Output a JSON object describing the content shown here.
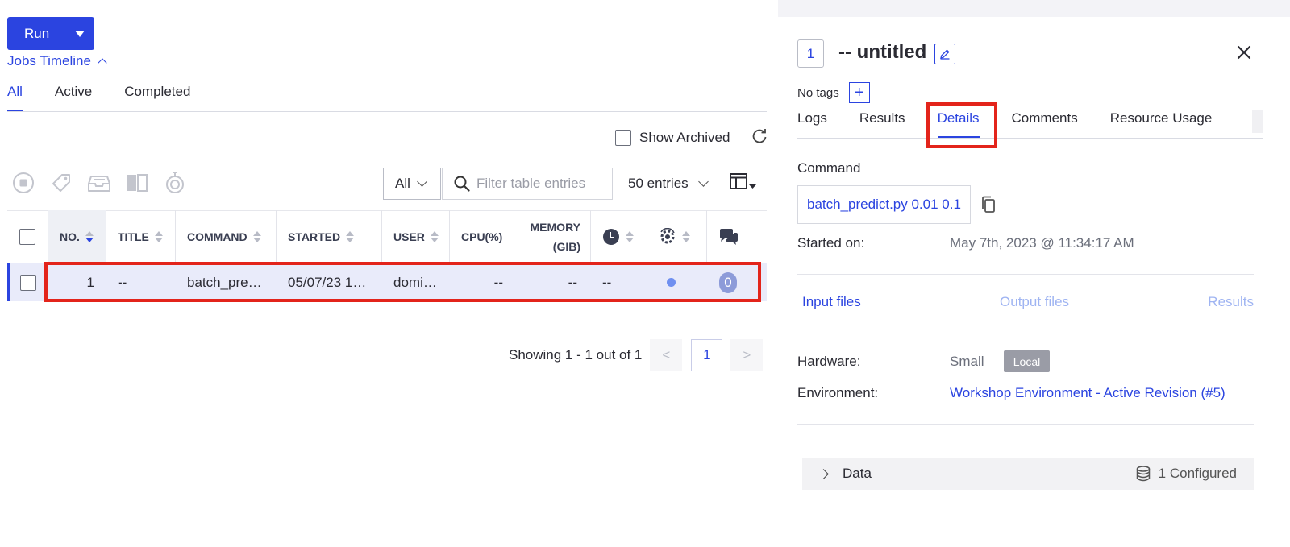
{
  "left": {
    "run_button": {
      "label": "Run"
    },
    "timeline_link": "Jobs Timeline",
    "tabs": [
      {
        "label": "All",
        "active": true
      },
      {
        "label": "Active",
        "active": false
      },
      {
        "label": "Completed",
        "active": false
      }
    ],
    "show_archived_label": "Show Archived",
    "status_filter": {
      "selected": "All"
    },
    "search": {
      "placeholder": "Filter table entries",
      "value": ""
    },
    "entries_label": "50 entries",
    "table": {
      "columns": {
        "no": "NO.",
        "title": "TITLE",
        "command": "COMMAND",
        "started": "STARTED",
        "user": "USER",
        "cpu": "CPU(%)",
        "memory_line1": "MEMORY",
        "memory_line2": "(GIB)"
      },
      "rows": [
        {
          "no": "1",
          "title": "--",
          "command": "batch_pre…",
          "started": "05/07/23 1…",
          "user": "domi…",
          "cpu": "--",
          "memory": "--",
          "duration": "--",
          "comments": "0"
        }
      ]
    },
    "pagination": {
      "summary": "Showing 1 - 1 out of 1",
      "current_page": "1",
      "prev": "<",
      "next": ">"
    }
  },
  "right": {
    "job_number": "1",
    "job_title": "-- untitled",
    "tags_label": "No tags",
    "add_tag": "+",
    "tabs": [
      {
        "label": "Logs",
        "active": false
      },
      {
        "label": "Results",
        "active": false
      },
      {
        "label": "Details",
        "active": true
      },
      {
        "label": "Comments",
        "active": false
      },
      {
        "label": "Resource Usage",
        "active": false
      }
    ],
    "command_label": "Command",
    "command_value": "batch_predict.py 0.01 0.1",
    "started_label": "Started on:",
    "started_value": "May 7th, 2023 @ 11:34:17 AM",
    "file_links": {
      "input": "Input files",
      "output": "Output files",
      "results": "Results"
    },
    "hardware_label": "Hardware:",
    "hardware_value": "Small",
    "hardware_badge": "Local",
    "environment_label": "Environment:",
    "environment_value": "Workshop Environment - Active Revision (#5)",
    "data_section": {
      "label": "Data",
      "configured": "1 Configured"
    }
  },
  "colors": {
    "accent": "#2b44e0",
    "highlight_box": "#e3241b",
    "selected_row": "#e9ebfa"
  }
}
